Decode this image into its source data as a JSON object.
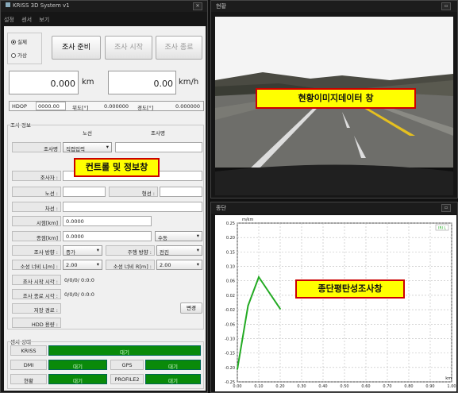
{
  "main_window": {
    "title": "KRISS 3D System v1",
    "menu": [
      "설정",
      "센서",
      "보기"
    ],
    "close": "✕"
  },
  "mode": {
    "real": "실제",
    "virtual": "가상"
  },
  "buttons": {
    "prepare": "조사 준비",
    "start": "조사 시작",
    "end": "조사 종료",
    "change": "변경"
  },
  "distance": {
    "value": "0.000",
    "unit": "km"
  },
  "speed": {
    "value": "0.00",
    "unit": "km/h"
  },
  "gps": {
    "hdop_label": "HDOP",
    "hdop": "0000.00",
    "lat_label": "위도[°]",
    "lat": "0.000000",
    "lon_label": "경도[°]",
    "lon": "0.000000"
  },
  "survey": {
    "section": "조사 정보",
    "route_header": "노선",
    "name_header": "조사명",
    "name_label": "조사명",
    "name_select": "직접입력",
    "surveyor": "조사자 :",
    "route": "노선 :",
    "shape": "형선 :",
    "lane": "차선 :",
    "start_pt_label": "시점[km]",
    "start_pt": "0.0000",
    "end_pt_label": "종점[km]",
    "end_pt": "0.0000",
    "end_mode": "수동",
    "dir_label": "조사 방향 :",
    "dir": "증가",
    "drive_label": "주행 방향 :",
    "drive": "전진",
    "width_l_label": "소성 너비 L[m] :",
    "width_l": "2.00",
    "width_r_label": "소성 너비 R[m] :",
    "width_r": "2.00",
    "start_time_label": "조사 시작 시각 :",
    "start_time": "0/0/0/ 0:0:0",
    "end_time_label": "조사 종료 시각 :",
    "end_time": "0/0/0/ 0:0:0",
    "save_path_label": "저장 경로 :",
    "hdd_label": "HDD 용량 :"
  },
  "sensors": {
    "section": "센서 상태",
    "kriss": "KRISS",
    "kriss_state": "대기",
    "dmi": "DMI",
    "dmi_state": "대기",
    "gps": "GPS",
    "gps_state": "대기",
    "cam": "현황",
    "cam_state": "대기",
    "profile": "PROFILE2",
    "profile_state": "대기"
  },
  "callouts": {
    "control": "컨트롤 및 정보창",
    "image": "현황이미지데이터 창",
    "chart": "종단평탄성조사창"
  },
  "image_window": {
    "title": "현황"
  },
  "chart_window": {
    "title": "종단"
  },
  "chart_data": {
    "type": "line",
    "ylabel": "m/km",
    "xlabel": "km",
    "legend": "IRI L",
    "x": [
      0.0,
      0.05,
      0.1,
      0.15,
      0.2
    ],
    "y": [
      -0.21,
      -0.01,
      0.08,
      0.03,
      -0.02
    ],
    "series_color": "#22aa22",
    "xlim": [
      0,
      1.0
    ],
    "ylim": [
      -0.25,
      0.25
    ],
    "xticks": [
      "0.00",
      "0.10",
      "0.20",
      "0.30",
      "0.40",
      "0.50",
      "0.60",
      "0.70",
      "0.80",
      "0.90",
      "1.00"
    ],
    "yticks": [
      "0.25",
      "0.20",
      "0.15",
      "0.10",
      "0.06",
      "0.02",
      "-0.02",
      "-0.06",
      "-0.10",
      "-0.15",
      "-0.20",
      "-0.25"
    ],
    "grid": true
  }
}
